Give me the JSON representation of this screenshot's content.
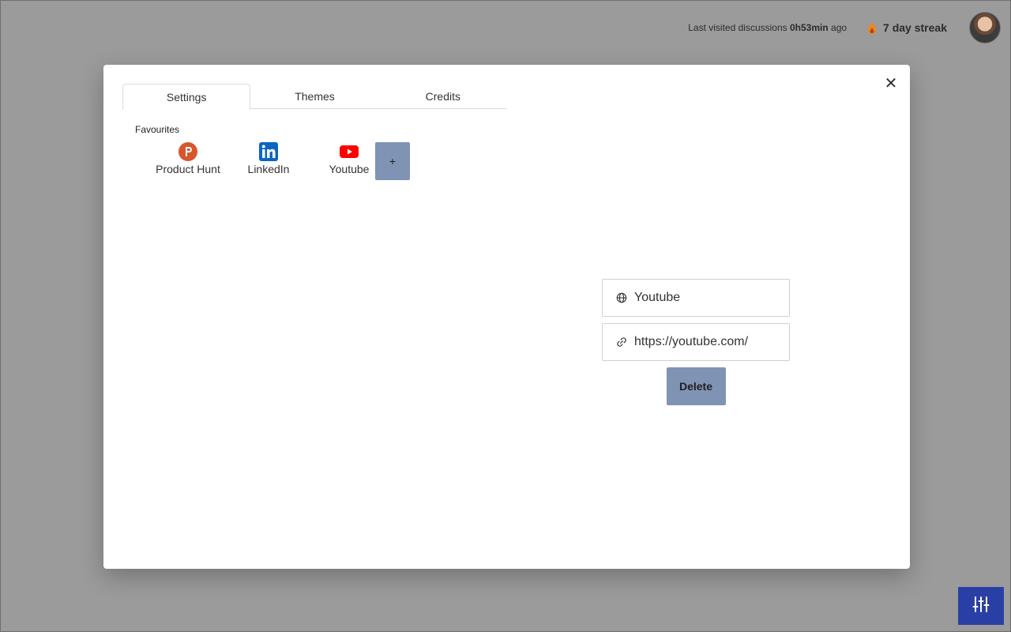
{
  "header": {
    "last_visited_prefix": "Last visited discussions",
    "last_visited_time": "0h53min",
    "last_visited_suffix": "ago",
    "streak_label": "7 day streak"
  },
  "modal": {
    "tabs": [
      {
        "label": "Settings",
        "active": true
      },
      {
        "label": "Themes",
        "active": false
      },
      {
        "label": "Credits",
        "active": false
      }
    ],
    "favourites_label": "Favourites",
    "favourites": [
      {
        "name": "Product Hunt",
        "icon": "product-hunt-icon",
        "color": "#da552f"
      },
      {
        "name": "LinkedIn",
        "icon": "linkedin-icon",
        "color": "#0a66c2"
      },
      {
        "name": "Youtube",
        "icon": "youtube-icon",
        "color": "#ff0000"
      }
    ],
    "add_label": "+",
    "edit": {
      "name_value": "Youtube",
      "url_value": "https://youtube.com/",
      "delete_label": "Delete"
    },
    "close_symbol": "✕"
  },
  "colors": {
    "overlay": "#9b9b9b",
    "button": "#7f93b4",
    "fab": "#2a3fa5"
  }
}
